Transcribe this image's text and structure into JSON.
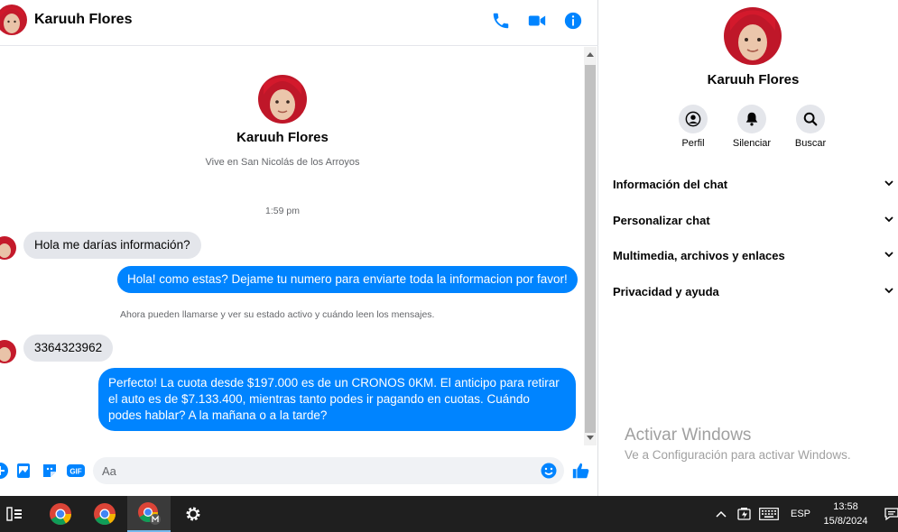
{
  "header": {
    "contact_name": "Karuuh Flores"
  },
  "profile": {
    "name": "Karuuh Flores",
    "subtitle": "Vive en San Nicolás de los Arroyos"
  },
  "messages": {
    "timestamp": "1:59 pm",
    "m1": "Hola me darías información?",
    "m2": "Hola! como estas? Dejame tu numero para enviarte toda la informacion por favor!",
    "system": "Ahora pueden llamarse y ver su estado activo y cuándo leen los mensajes.",
    "m3": "3364323962",
    "m4": "Perfecto! La cuota desde $197.000 es de un CRONOS 0KM. El anticipo para retirar el auto es de $7.133.400, mientras tanto podes ir pagando en cuotas. Cuándo podes hablar? A la mañana o a la tarde?"
  },
  "composer": {
    "placeholder": "Aa",
    "gif_label": "GIF"
  },
  "info_panel": {
    "name": "Karuuh Flores",
    "actions": [
      {
        "label": "Perfil",
        "icon": "profile-icon"
      },
      {
        "label": "Silenciar",
        "icon": "bell-icon"
      },
      {
        "label": "Buscar",
        "icon": "search-icon"
      }
    ],
    "sections": [
      "Información del chat",
      "Personalizar chat",
      "Multimedia, archivos y enlaces",
      "Privacidad y ayuda"
    ]
  },
  "watermark": {
    "title": "Activar Windows",
    "subtitle": "Ve a Configuración para activar Windows."
  },
  "taskbar": {
    "language": "ESP",
    "time": "13:58",
    "date": "15/8/2024"
  },
  "colors": {
    "accent": "#0084ff",
    "incoming_bubble": "#e4e6eb",
    "taskbar": "#1f1f1f"
  }
}
